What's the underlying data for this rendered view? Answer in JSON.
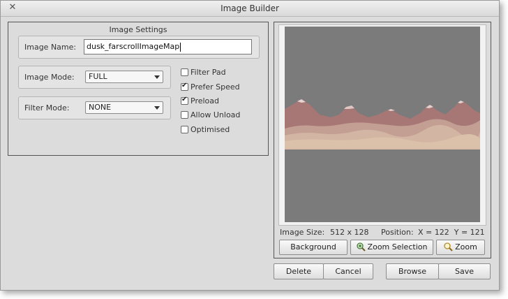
{
  "window": {
    "title": "Image Builder"
  },
  "settings": {
    "title": "Image Settings",
    "image_name_label": "Image Name:",
    "image_name_value": "dusk_farscrollImageMap",
    "image_mode_label": "Image Mode:",
    "image_mode_value": "FULL",
    "filter_mode_label": "Filter Mode:",
    "filter_mode_value": "NONE"
  },
  "options": [
    {
      "label": "Filter Pad",
      "checked": false
    },
    {
      "label": "Prefer Speed",
      "checked": true
    },
    {
      "label": "Preload",
      "checked": true
    },
    {
      "label": "Allow Unload",
      "checked": false
    },
    {
      "label": "Optimised",
      "checked": false
    }
  ],
  "info": {
    "size_label": "Image Size:",
    "size_value": "512 x 128",
    "position_label": "Position:",
    "position_value": "X = 122  Y = 121"
  },
  "preview_buttons": {
    "background": "Background",
    "zoom_selection": "Zoom Selection",
    "zoom": "Zoom"
  },
  "actions": {
    "delete": "Delete",
    "cancel": "Cancel",
    "browse": "Browse",
    "save": "Save"
  },
  "icons": {
    "close": "close-icon",
    "zoom_selection": "magnifier-plus-icon",
    "zoom": "magnifier-icon"
  },
  "colors": {
    "preview_bg": "#7b7b7b",
    "mountain": "#a87a78",
    "sand": "#dcc1aa"
  }
}
